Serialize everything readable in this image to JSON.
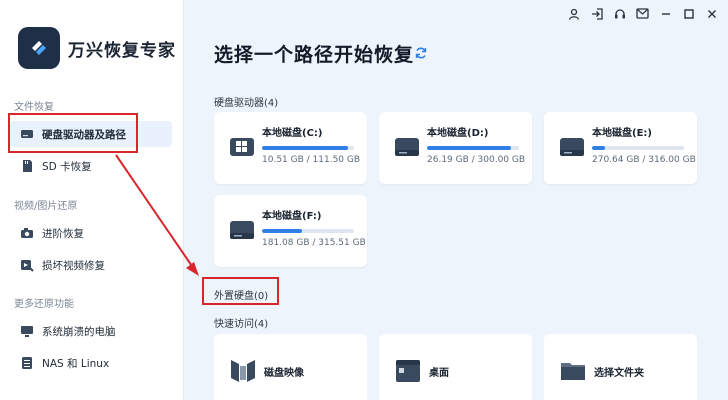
{
  "app": {
    "title": "万兴恢复专家"
  },
  "sidebar": {
    "sections": [
      {
        "label": "文件恢复",
        "items": [
          {
            "label": "硬盘驱动器及路径",
            "icon": "hard-drive-icon",
            "active": true
          },
          {
            "label": "SD 卡恢复",
            "icon": "sd-card-icon",
            "active": false
          }
        ]
      },
      {
        "label": "视频/图片还原",
        "items": [
          {
            "label": "进阶恢复",
            "icon": "camera-icon",
            "active": false
          },
          {
            "label": "损坏视频修复",
            "icon": "video-repair-icon",
            "active": false
          }
        ]
      },
      {
        "label": "更多还原功能",
        "items": [
          {
            "label": "系统崩溃的电脑",
            "icon": "monitor-icon",
            "active": false
          },
          {
            "label": "NAS 和 Linux",
            "icon": "nas-server-icon",
            "active": false
          }
        ]
      }
    ]
  },
  "topbar": {
    "icons": [
      "user-icon",
      "login-icon",
      "support-headset-icon",
      "mail-icon",
      "minimize-icon",
      "maximize-icon",
      "close-icon"
    ]
  },
  "main": {
    "title": "选择一个路径开始恢复",
    "drives_label": "硬盘驱动器(4)",
    "drives": [
      {
        "name": "本地磁盘(C:)",
        "size": "10.51 GB / 111.50 GB",
        "used_fraction": 0.94,
        "icon": "windows-drive-icon"
      },
      {
        "name": "本地磁盘(D:)",
        "size": "26.19 GB / 300.00 GB",
        "used_fraction": 0.91,
        "icon": "drive-icon"
      },
      {
        "name": "本地磁盘(E:)",
        "size": "270.64 GB / 316.00 GB",
        "used_fraction": 0.14,
        "icon": "drive-icon"
      },
      {
        "name": "本地磁盘(F:)",
        "size": "181.08 GB / 315.51 GB",
        "used_fraction": 0.43,
        "icon": "drive-icon"
      }
    ],
    "external_label": "外置硬盘(0)",
    "quick_label": "快速访问(4)",
    "quick": [
      {
        "name": "磁盘映像",
        "icon": "disk-image-icon"
      },
      {
        "name": "桌面",
        "icon": "desktop-icon"
      },
      {
        "name": "选择文件夹",
        "icon": "folder-icon"
      }
    ]
  },
  "colors": {
    "accent": "#2f7fe6",
    "annotation_red": "#d9262c",
    "background": "#eef4fb"
  }
}
